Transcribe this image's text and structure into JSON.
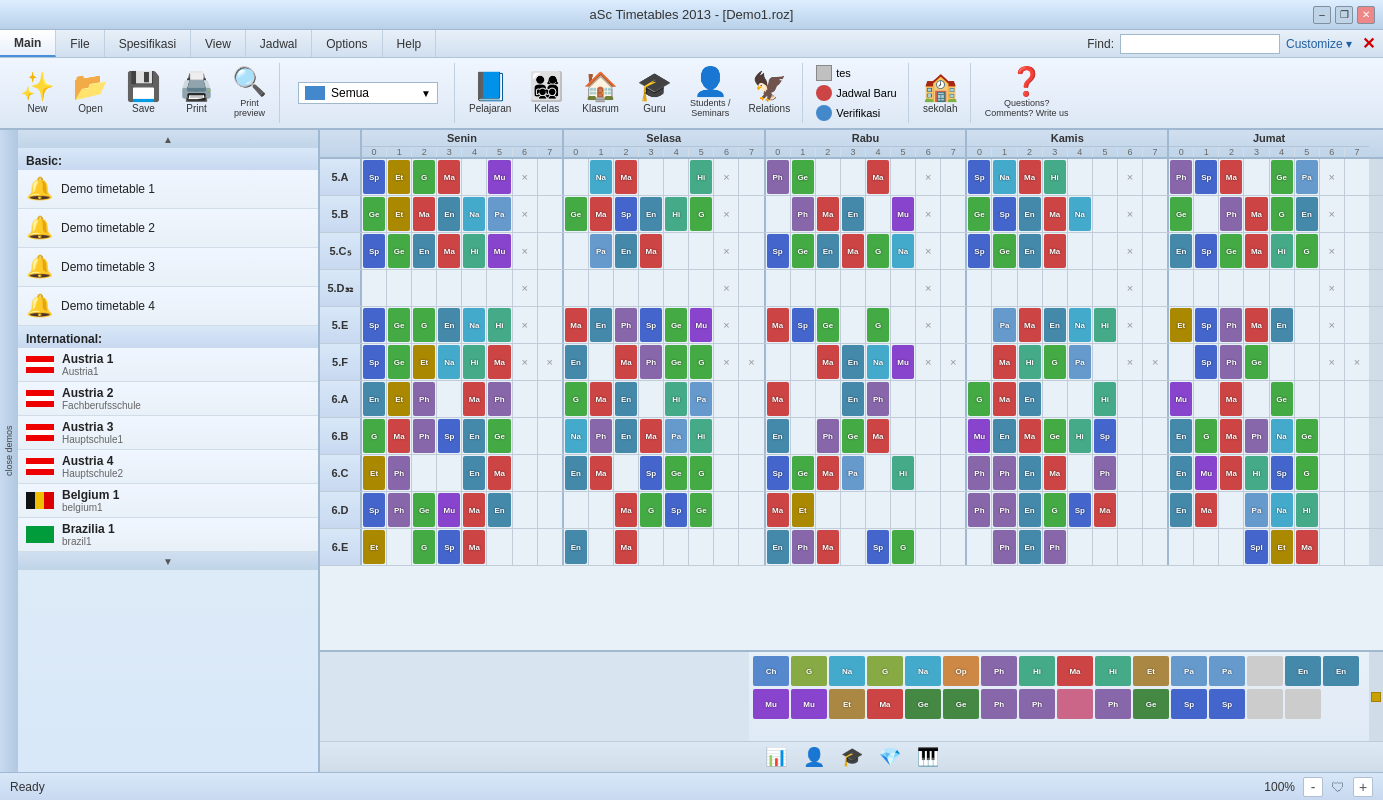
{
  "window": {
    "title": "aSc Timetables 2013  -  [Demo1.roz]"
  },
  "titlebar": {
    "minimize": "–",
    "restore": "❐",
    "close": "✕"
  },
  "menubar": {
    "tabs": [
      "Main",
      "File",
      "Spesifikasi",
      "View",
      "Jadwal",
      "Options",
      "Help"
    ],
    "active": "Main",
    "find_label": "Find:",
    "customize_label": "Customize ▾"
  },
  "toolbar": {
    "new_label": "New",
    "open_label": "Open",
    "save_label": "Save",
    "print_label": "Print",
    "print_preview_label": "Print\npreview",
    "pelajaran_label": "Pelajaran",
    "kelas_label": "Kelas",
    "klasrum_label": "Klasrum",
    "guru_label": "Guru",
    "students_label": "Students /\nSeminars",
    "relations_label": "Relations",
    "tes_label": "tes",
    "jadwal_baru_label": "Jadwal Baru",
    "verifikasi_label": "Verifikasi",
    "sekolah_label": "sekolah",
    "questions_label": "Questions?\nComments? Write us",
    "semua_label": "Semua"
  },
  "sidebar": {
    "close_demos_label": "close demos",
    "basic_section": "Basic:",
    "demos": [
      {
        "name": "Demo timetable 1"
      },
      {
        "name": "Demo timetable 2"
      },
      {
        "name": "Demo timetable 3"
      },
      {
        "name": "Demo timetable 4"
      }
    ],
    "international_section": "International:",
    "countries": [
      {
        "name": "Austria 1",
        "sub": "Austria1",
        "flag": "austria"
      },
      {
        "name": "Austria 2",
        "sub": "Fachberufsschule",
        "flag": "austria"
      },
      {
        "name": "Austria 3",
        "sub": "Hauptschule1",
        "flag": "austria"
      },
      {
        "name": "Austria 4",
        "sub": "Hauptschule2",
        "flag": "austria"
      },
      {
        "name": "Belgium 1",
        "sub": "belgium1",
        "flag": "belgium"
      },
      {
        "name": "Brazilia 1",
        "sub": "brazil1",
        "flag": "brazil"
      }
    ]
  },
  "timetable": {
    "days": [
      "Senin",
      "Selasa",
      "Rabu",
      "Kamis",
      "Jumat"
    ],
    "time_slots": [
      "0",
      "1",
      "2",
      "3",
      "4",
      "5",
      "6",
      "7"
    ],
    "rows": [
      {
        "label": "5.A"
      },
      {
        "label": "5.B"
      },
      {
        "label": "5.C₅"
      },
      {
        "label": "5.D₃₂"
      },
      {
        "label": "5.E"
      },
      {
        "label": "5.F"
      },
      {
        "label": "6.A"
      },
      {
        "label": "6.B"
      },
      {
        "label": "6.C"
      },
      {
        "label": "6.D"
      },
      {
        "label": "6.E"
      }
    ]
  },
  "status": {
    "ready_label": "Ready",
    "zoom_level": "100%"
  },
  "bottom_panel": {
    "blocks1": [
      {
        "label": "Ch",
        "color": "#5588cc"
      },
      {
        "label": "G",
        "color": "#88aa44"
      },
      {
        "label": "Na",
        "color": "#44aacc"
      },
      {
        "label": "G",
        "color": "#88aa44"
      },
      {
        "label": "Na",
        "color": "#44aacc"
      },
      {
        "label": "Op",
        "color": "#cc8844"
      },
      {
        "label": "Ph",
        "color": "#8866aa"
      },
      {
        "label": "Hi",
        "color": "#44aa88"
      },
      {
        "label": "Ma",
        "color": "#cc4444"
      },
      {
        "label": "Hi",
        "color": "#44aa88"
      },
      {
        "label": "Et",
        "color": "#aa8844"
      },
      {
        "label": "Pa",
        "color": "#6699cc"
      },
      {
        "label": "Pa",
        "color": "#6699cc"
      },
      {
        "label": "",
        "color": "#cccccc"
      },
      {
        "label": "En",
        "color": "#4488aa"
      },
      {
        "label": "En",
        "color": "#4488aa"
      }
    ],
    "blocks2": [
      {
        "label": "Mu",
        "color": "#8844cc"
      },
      {
        "label": "Mu",
        "color": "#8844cc"
      },
      {
        "label": "Et",
        "color": "#aa8844"
      },
      {
        "label": "Ma",
        "color": "#cc4444"
      },
      {
        "label": "Ge",
        "color": "#448844"
      },
      {
        "label": "Ge",
        "color": "#448844"
      },
      {
        "label": "Ph",
        "color": "#8866aa"
      },
      {
        "label": "Ph",
        "color": "#8866aa"
      },
      {
        "label": "",
        "color": "#cc6688"
      },
      {
        "label": "Ph",
        "color": "#8866aa"
      },
      {
        "label": "Ge",
        "color": "#448844"
      },
      {
        "label": "Sp",
        "color": "#4466cc"
      },
      {
        "label": "Sp",
        "color": "#4466cc"
      },
      {
        "label": "",
        "color": "#cccccc"
      },
      {
        "label": "",
        "color": "#cccccc"
      }
    ]
  }
}
